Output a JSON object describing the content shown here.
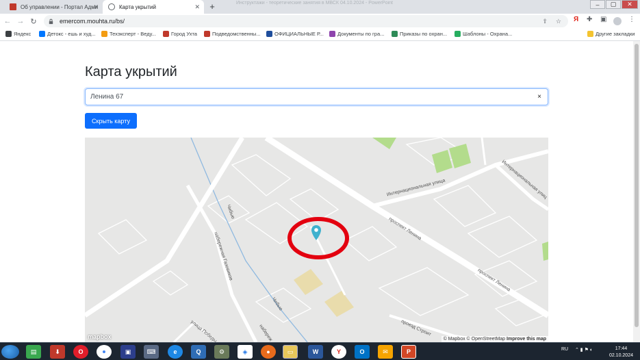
{
  "browser": {
    "tabs": [
      {
        "title": "Об управлении - Портал Адми"
      },
      {
        "title": "Карта укрытий"
      }
    ],
    "ghost_title": "Инструктажи - теоретические занятия в МВСК 04.10.2024 - PowerPoint",
    "url": "emercom.mouhta.ru/bs/"
  },
  "bookmarks": [
    {
      "label": "Яндекс",
      "icon": "yandex-icon",
      "color": "#3c4043"
    },
    {
      "label": "Детокс - ешь и худ...",
      "icon": "vk-icon",
      "color": "#0077ff"
    },
    {
      "label": "Техэксперт - Веду...",
      "icon": "techexpert-icon",
      "color": "#f39c12"
    },
    {
      "label": "Город Ухта",
      "icon": "city-icon",
      "color": "#c0392b"
    },
    {
      "label": "Подведомственны...",
      "icon": "city-icon",
      "color": "#c0392b"
    },
    {
      "label": "ОФИЦИАЛЬНЫЕ Р...",
      "icon": "official-icon",
      "color": "#1f4e9c"
    },
    {
      "label": "Документы по гра...",
      "icon": "docs-icon",
      "color": "#8e44ad"
    },
    {
      "label": "Приказы по охран...",
      "icon": "ti-icon",
      "color": "#2e8b57"
    },
    {
      "label": "Шаблоны - Охрана...",
      "icon": "templates-icon",
      "color": "#27ae60"
    },
    {
      "label": "Другие закладки",
      "icon": "folder-icon",
      "color": "#f4c430"
    }
  ],
  "page": {
    "title": "Карта укрытий",
    "search_value": "Ленина 67",
    "clear_label": "×",
    "hide_map_label": "Скрыть карту"
  },
  "map": {
    "street_labels": [
      "Интернациональная улица",
      "Интернациональная улиц",
      "проспект Ленина",
      "проспект Ленина",
      "набережная Газовиков",
      "Чибью",
      "Чибью",
      "улица Победы",
      "набереж",
      "проезд Строит"
    ],
    "logo": "mapbox",
    "attribution": [
      "© Mapbox",
      "© OpenStreetMap",
      "Improve this map"
    ],
    "marker_color": "#3fb1ce",
    "highlight_color": "#e3000f"
  },
  "taskbar": {
    "lang": "RU",
    "time": "17:44",
    "date": "02.10.2024"
  },
  "colors": {
    "accent": "#0d6efd"
  }
}
